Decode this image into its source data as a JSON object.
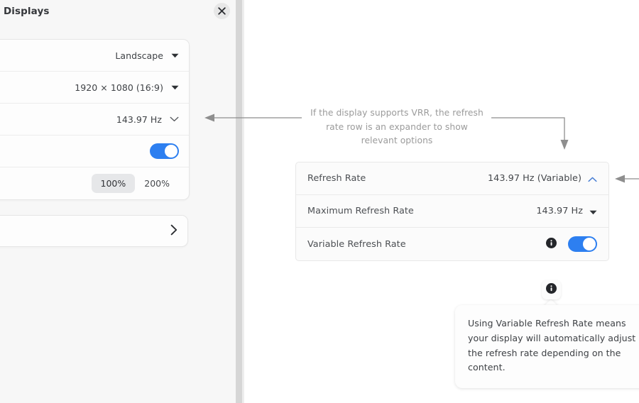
{
  "window": {
    "title": "Displays",
    "close_icon": "close-icon"
  },
  "left_panel": {
    "rows": [
      {
        "value": "Landscape",
        "caret": "triangle-down-icon"
      },
      {
        "value": "1920 × 1080 (16:9)",
        "caret": "triangle-down-icon"
      },
      {
        "value": "143.97 Hz",
        "caret": "chevron-down-icon"
      },
      {
        "value": "",
        "caret": "toggle"
      },
      {
        "value": "",
        "caret": "segmented"
      }
    ],
    "scale_options": [
      {
        "label": "100%",
        "active": true
      },
      {
        "label": "200%",
        "active": false
      }
    ],
    "secondary_row_caret": "chevron-right-icon"
  },
  "annotation": {
    "text": "If the display supports VRR, the refresh rate row is an expander to show relevant options",
    "line_color": "#8e8e8e"
  },
  "refresh_card": {
    "rows": [
      {
        "label": "Refresh Rate",
        "value": "143.97 Hz (Variable)",
        "control": "chevron-up-icon",
        "accent": "#4a7fd4"
      },
      {
        "label": "Maximum Refresh Rate",
        "value": "143.97 Hz",
        "control": "triangle-down-icon",
        "accent": "#3b3e42"
      },
      {
        "label": "Variable Refresh Rate",
        "value": "",
        "control": "toggle",
        "accent": "#2d7ff0"
      }
    ],
    "info_icon": "info-icon",
    "toggle_on": true
  },
  "tooltip": {
    "icon": "info-icon",
    "text": "Using Variable Refresh Rate means your display will automatically adjust the refresh rate depending on the content."
  },
  "colors": {
    "toggle_on": "#2d7ff0",
    "accent_chevron": "#4a7fd4",
    "window_bg": "#f7f7f7",
    "card_bg": "#fbfbfb",
    "annotation_text": "#9b9b9b"
  }
}
